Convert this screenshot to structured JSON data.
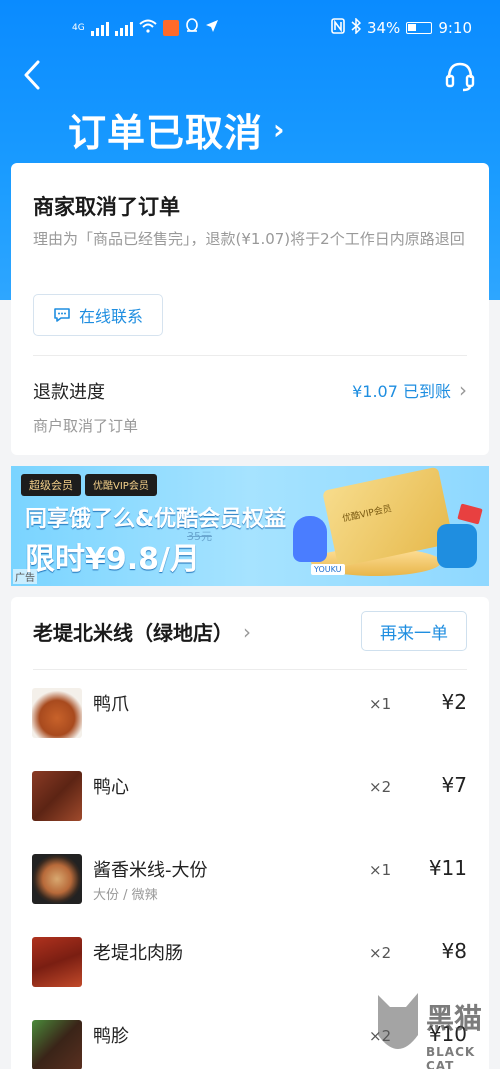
{
  "status_bar": {
    "network": "4G",
    "battery": "34%",
    "time": "9:10"
  },
  "header": {
    "title": "订单已取消",
    "title_chevron": "›"
  },
  "cancel_card": {
    "title": "商家取消了订单",
    "reason": "理由为「商品已经售完」，退款(¥1.07)将于2个工作日内原路退回",
    "contact_label": "在线联系",
    "refund_label": "退款进度",
    "refund_status": "¥1.07 已到账",
    "refund_sub": "商户取消了订单"
  },
  "banner": {
    "badge1": "超级会员",
    "badge2": "优酷VIP会员",
    "line1": "同享饿了么&优酷会员权益",
    "line2": "限时¥9.8/月",
    "old_price": "35元",
    "ad_label": "广告",
    "card_text": "优酷VIP会员",
    "brand": "YOUKU"
  },
  "store": {
    "name": "老堤北米线（绿地店）",
    "reorder_label": "再来一单",
    "items": [
      {
        "name": "鸭爪",
        "spec": "",
        "qty": "×1",
        "price": "¥2"
      },
      {
        "name": "鸭心",
        "spec": "",
        "qty": "×2",
        "price": "¥7"
      },
      {
        "name": "酱香米线-大份",
        "spec": "大份 / 微辣",
        "qty": "×1",
        "price": "¥11"
      },
      {
        "name": "老堤北肉肠",
        "spec": "",
        "qty": "×2",
        "price": "¥8"
      },
      {
        "name": "鸭胗",
        "spec": "",
        "qty": "×2",
        "price": "¥10"
      }
    ]
  },
  "watermark": {
    "text": "黑猫",
    "sub": "BLACK CAT"
  },
  "colors": {
    "header_blue": "#0a8bff",
    "link_blue": "#1f8ee0"
  }
}
